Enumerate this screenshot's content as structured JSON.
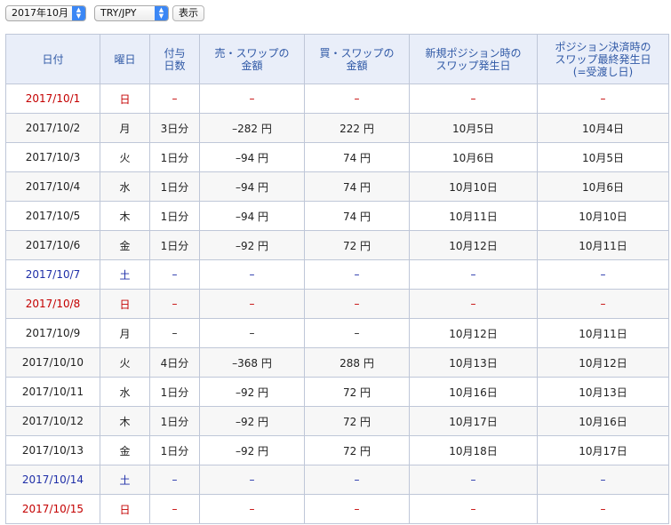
{
  "controls": {
    "month_value": "2017年10月",
    "pair_value": "TRY/JPY",
    "show_button": "表示"
  },
  "table": {
    "headers": [
      "日付",
      "曜日",
      "付与\n日数",
      "売・スワップの\n金額",
      "買・スワップの\n金額",
      "新規ポジション時の\nスワップ発生日",
      "ポジション決済時の\nスワップ最終発生日\n(=受渡し日)"
    ],
    "rows": [
      {
        "date": "2017/10/1",
        "dow": "日",
        "days": "–",
        "sell": "–",
        "buy": "–",
        "new_date": "–",
        "settle_date": "–",
        "kind": "sun"
      },
      {
        "date": "2017/10/2",
        "dow": "月",
        "days": "3日分",
        "sell": "–282 円",
        "buy": "222 円",
        "new_date": "10月5日",
        "settle_date": "10月4日",
        "kind": "weekday"
      },
      {
        "date": "2017/10/3",
        "dow": "火",
        "days": "1日分",
        "sell": "–94 円",
        "buy": "74 円",
        "new_date": "10月6日",
        "settle_date": "10月5日",
        "kind": "weekday"
      },
      {
        "date": "2017/10/4",
        "dow": "水",
        "days": "1日分",
        "sell": "–94 円",
        "buy": "74 円",
        "new_date": "10月10日",
        "settle_date": "10月6日",
        "kind": "weekday"
      },
      {
        "date": "2017/10/5",
        "dow": "木",
        "days": "1日分",
        "sell": "–94 円",
        "buy": "74 円",
        "new_date": "10月11日",
        "settle_date": "10月10日",
        "kind": "weekday"
      },
      {
        "date": "2017/10/6",
        "dow": "金",
        "days": "1日分",
        "sell": "–92 円",
        "buy": "72 円",
        "new_date": "10月12日",
        "settle_date": "10月11日",
        "kind": "weekday"
      },
      {
        "date": "2017/10/7",
        "dow": "土",
        "days": "–",
        "sell": "–",
        "buy": "–",
        "new_date": "–",
        "settle_date": "–",
        "kind": "sat"
      },
      {
        "date": "2017/10/8",
        "dow": "日",
        "days": "–",
        "sell": "–",
        "buy": "–",
        "new_date": "–",
        "settle_date": "–",
        "kind": "sun"
      },
      {
        "date": "2017/10/9",
        "dow": "月",
        "days": "–",
        "sell": "–",
        "buy": "–",
        "new_date": "10月12日",
        "settle_date": "10月11日",
        "kind": "weekday"
      },
      {
        "date": "2017/10/10",
        "dow": "火",
        "days": "4日分",
        "sell": "–368 円",
        "buy": "288 円",
        "new_date": "10月13日",
        "settle_date": "10月12日",
        "kind": "weekday"
      },
      {
        "date": "2017/10/11",
        "dow": "水",
        "days": "1日分",
        "sell": "–92 円",
        "buy": "72 円",
        "new_date": "10月16日",
        "settle_date": "10月13日",
        "kind": "weekday"
      },
      {
        "date": "2017/10/12",
        "dow": "木",
        "days": "1日分",
        "sell": "–92 円",
        "buy": "72 円",
        "new_date": "10月17日",
        "settle_date": "10月16日",
        "kind": "weekday"
      },
      {
        "date": "2017/10/13",
        "dow": "金",
        "days": "1日分",
        "sell": "–92 円",
        "buy": "72 円",
        "new_date": "10月18日",
        "settle_date": "10月17日",
        "kind": "weekday"
      },
      {
        "date": "2017/10/14",
        "dow": "土",
        "days": "–",
        "sell": "–",
        "buy": "–",
        "new_date": "–",
        "settle_date": "–",
        "kind": "sat"
      },
      {
        "date": "2017/10/15",
        "dow": "日",
        "days": "–",
        "sell": "–",
        "buy": "–",
        "new_date": "–",
        "settle_date": "–",
        "kind": "sun"
      }
    ]
  },
  "colors": {
    "header_bg": "#e9eef9",
    "header_text": "#3059a6",
    "border": "#bfc7d8",
    "sunday_red": "#c40000",
    "saturday_blue": "#1f2fa8",
    "select_arrow_blue": "#3b87f5"
  }
}
